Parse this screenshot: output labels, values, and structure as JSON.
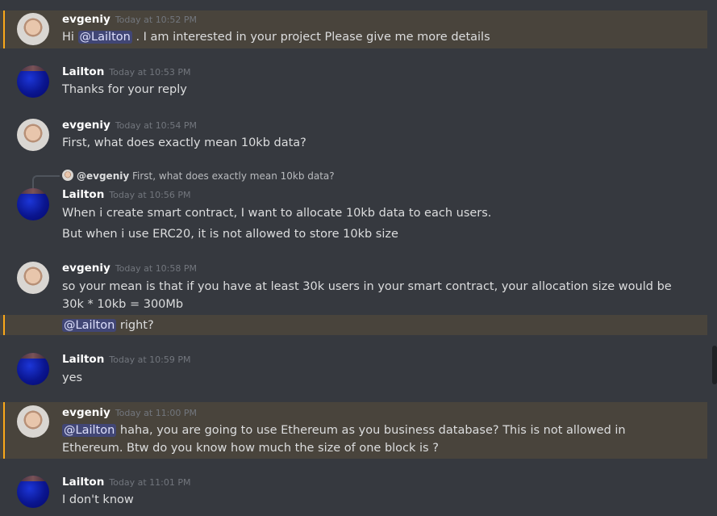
{
  "messages": [
    {
      "author": "evgeniy",
      "time": "Today at 10:52 PM",
      "mention": "@Lailton",
      "text": ". I am interested in your project Please give me more details",
      "prefix": "Hi"
    },
    {
      "author": "Lailton",
      "time": "Today at 10:53 PM",
      "text": "Thanks for your reply"
    },
    {
      "author": "evgeniy",
      "time": "Today at 10:54 PM",
      "text": "First, what does exactly mean 10kb data?"
    },
    {
      "reply": {
        "author": "@evgeniy",
        "text": "First, what does exactly mean 10kb data?"
      },
      "author": "Lailton",
      "time": "Today at 10:56 PM",
      "text": "When i create smart contract, I want to allocate 10kb data to each users.",
      "text2": "But when i use ERC20, it is not allowed to store 10kb size"
    },
    {
      "author": "evgeniy",
      "time": "Today at 10:58 PM",
      "text": "so your mean is that if you have at least 30k users in your smart contract, your allocation size would be 30k * 10kb = 300Mb",
      "mention": "@Lailton",
      "text2": "right?"
    },
    {
      "author": "Lailton",
      "time": "Today at 10:59 PM",
      "text": "yes"
    },
    {
      "author": "evgeniy",
      "time": "Today at 11:00 PM",
      "mention": "@Lailton",
      "text": "haha, you are going to use Ethereum as you business database? This is not allowed in Ethereum. Btw do you know how much the size of one block is ?"
    },
    {
      "author": "Lailton",
      "time": "Today at 11:01 PM",
      "text": "I don't know"
    }
  ]
}
